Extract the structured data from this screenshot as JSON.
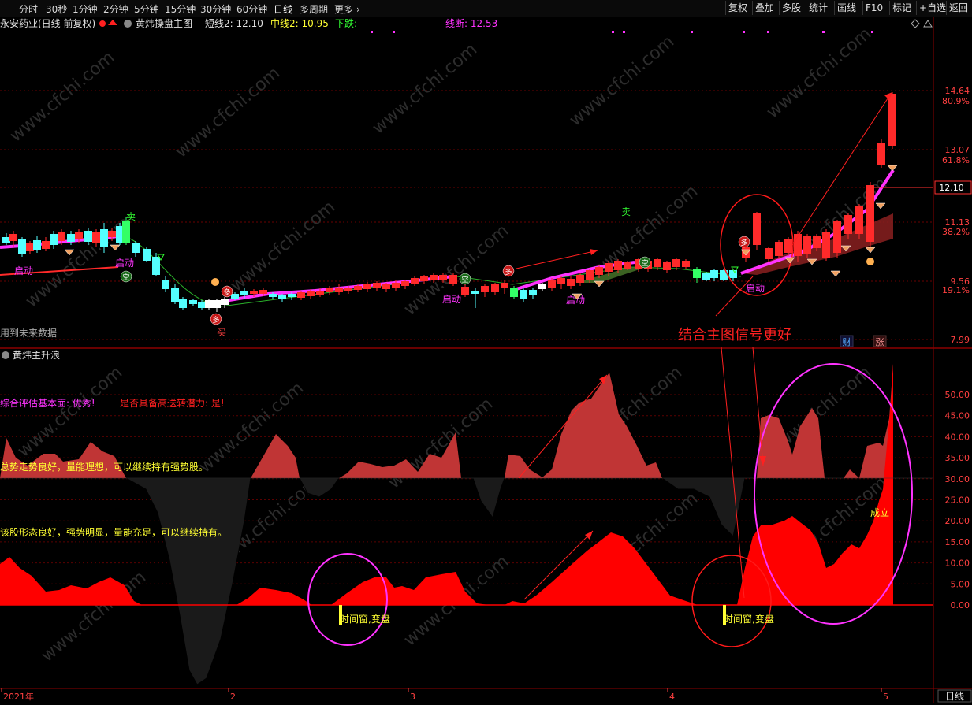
{
  "toolbar": {
    "periods": [
      "分时",
      "30秒",
      "1分钟",
      "2分钟",
      "5分钟",
      "15分钟",
      "30分钟",
      "60分钟",
      "日线",
      "多周期",
      "更多 ›"
    ],
    "active_period": "日线",
    "right_buttons": [
      "复权",
      "叠加",
      "多股",
      "统计",
      "画线",
      "F10",
      "标记",
      "+自选",
      "返回"
    ]
  },
  "main_chart": {
    "stock_title": "永安药业(日线 前复权)",
    "formula_name": "黄炜操盘主图",
    "short_line": "短线2: 12.10",
    "mid_line": "中线2: 10.95",
    "down_label": "下跌: -",
    "break_line": "线断: 12.53",
    "price_labels": [
      "14.64",
      "13.07",
      "12.10",
      "11.13",
      "9.56",
      "7.99"
    ],
    "pct_labels": [
      "80.9%",
      "61.8%",
      "38.2%",
      "19.1%"
    ],
    "current_price_box": "12.10",
    "annotations": [
      "启动",
      "启动",
      "启动",
      "启动",
      "启动",
      "卖",
      "卖",
      "买",
      "空",
      "空",
      "空",
      "多",
      "多",
      "多",
      "多"
    ],
    "future_data_note": "用到未来数据",
    "tip": "结合主图信号更好",
    "badges": [
      "财",
      "涨"
    ]
  },
  "sub_chart": {
    "formula_name": "黄炜主升浪",
    "text1a": "综合评估基本面: 优秀!",
    "text1b": "是否具备高送转潜力: 是!",
    "text2": "总势走势良好，量能理想，可以继续持有强势股。",
    "text3": "该股形态良好，强势明显，量能充足，可以继续持有。",
    "label_established": "成立",
    "label_window1": "时间窗,变盘",
    "label_window2": "时间窗,变盘",
    "y_labels": [
      "50.00",
      "45.00",
      "40.00",
      "35.00",
      "30.00",
      "25.00",
      "20.00",
      "15.00",
      "10.00",
      "5.00",
      "0.00"
    ]
  },
  "x_axis": {
    "labels": [
      "2021年",
      "2",
      "3",
      "4",
      "5"
    ],
    "period_box": "日线"
  },
  "colors": {
    "background": "#000000",
    "grid": "#7a0000",
    "up": "#ff2a2a",
    "down": "#54ffff",
    "magenta_line": "#ff33ff",
    "yellow_text": "#ffff33",
    "axis_text": "#ff4040"
  },
  "watermark": "www.cfchi.com"
}
